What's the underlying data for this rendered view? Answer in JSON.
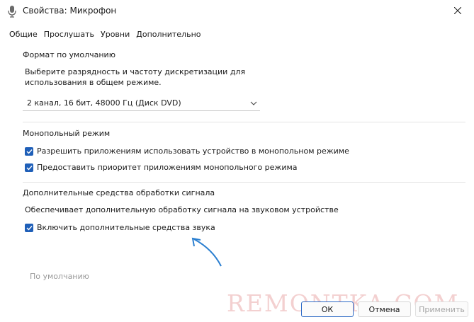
{
  "window": {
    "title": "Свойства: Микрофон"
  },
  "tabs": [
    {
      "label": "Общие"
    },
    {
      "label": "Прослушать"
    },
    {
      "label": "Уровни"
    },
    {
      "label": "Дополнительно"
    }
  ],
  "default_format": {
    "title": "Формат по умолчанию",
    "description_line1": "Выберите разрядность и частоту дискретизации для",
    "description_line2": "использования в общем режиме.",
    "selected_value": "2 канал, 16 бит, 48000 Гц (Диск DVD)"
  },
  "exclusive_mode": {
    "title": "Монопольный режим",
    "options": [
      {
        "label": "Разрешить приложениям использовать устройство в монопольном режиме",
        "checked": true
      },
      {
        "label": "Предоставить приоритет приложениям монопольного режима",
        "checked": true
      }
    ]
  },
  "signal_enhancements": {
    "title": "Дополнительные средства обработки сигнала",
    "description": "Обеспечивает дополнительную обработку сигнала на звуковом устройстве",
    "option_label": "Включить дополнительные средства звука",
    "option_checked": true
  },
  "restore_defaults_label": "По умолчанию",
  "watermark_text": "REMONTKA.COM",
  "buttons": {
    "ok": "ОК",
    "cancel": "Отмена",
    "apply": "Применить"
  },
  "colors": {
    "accent": "#1f5fb8",
    "disabled_text": "#a6a6a6",
    "arrow": "#2b7fd0"
  }
}
